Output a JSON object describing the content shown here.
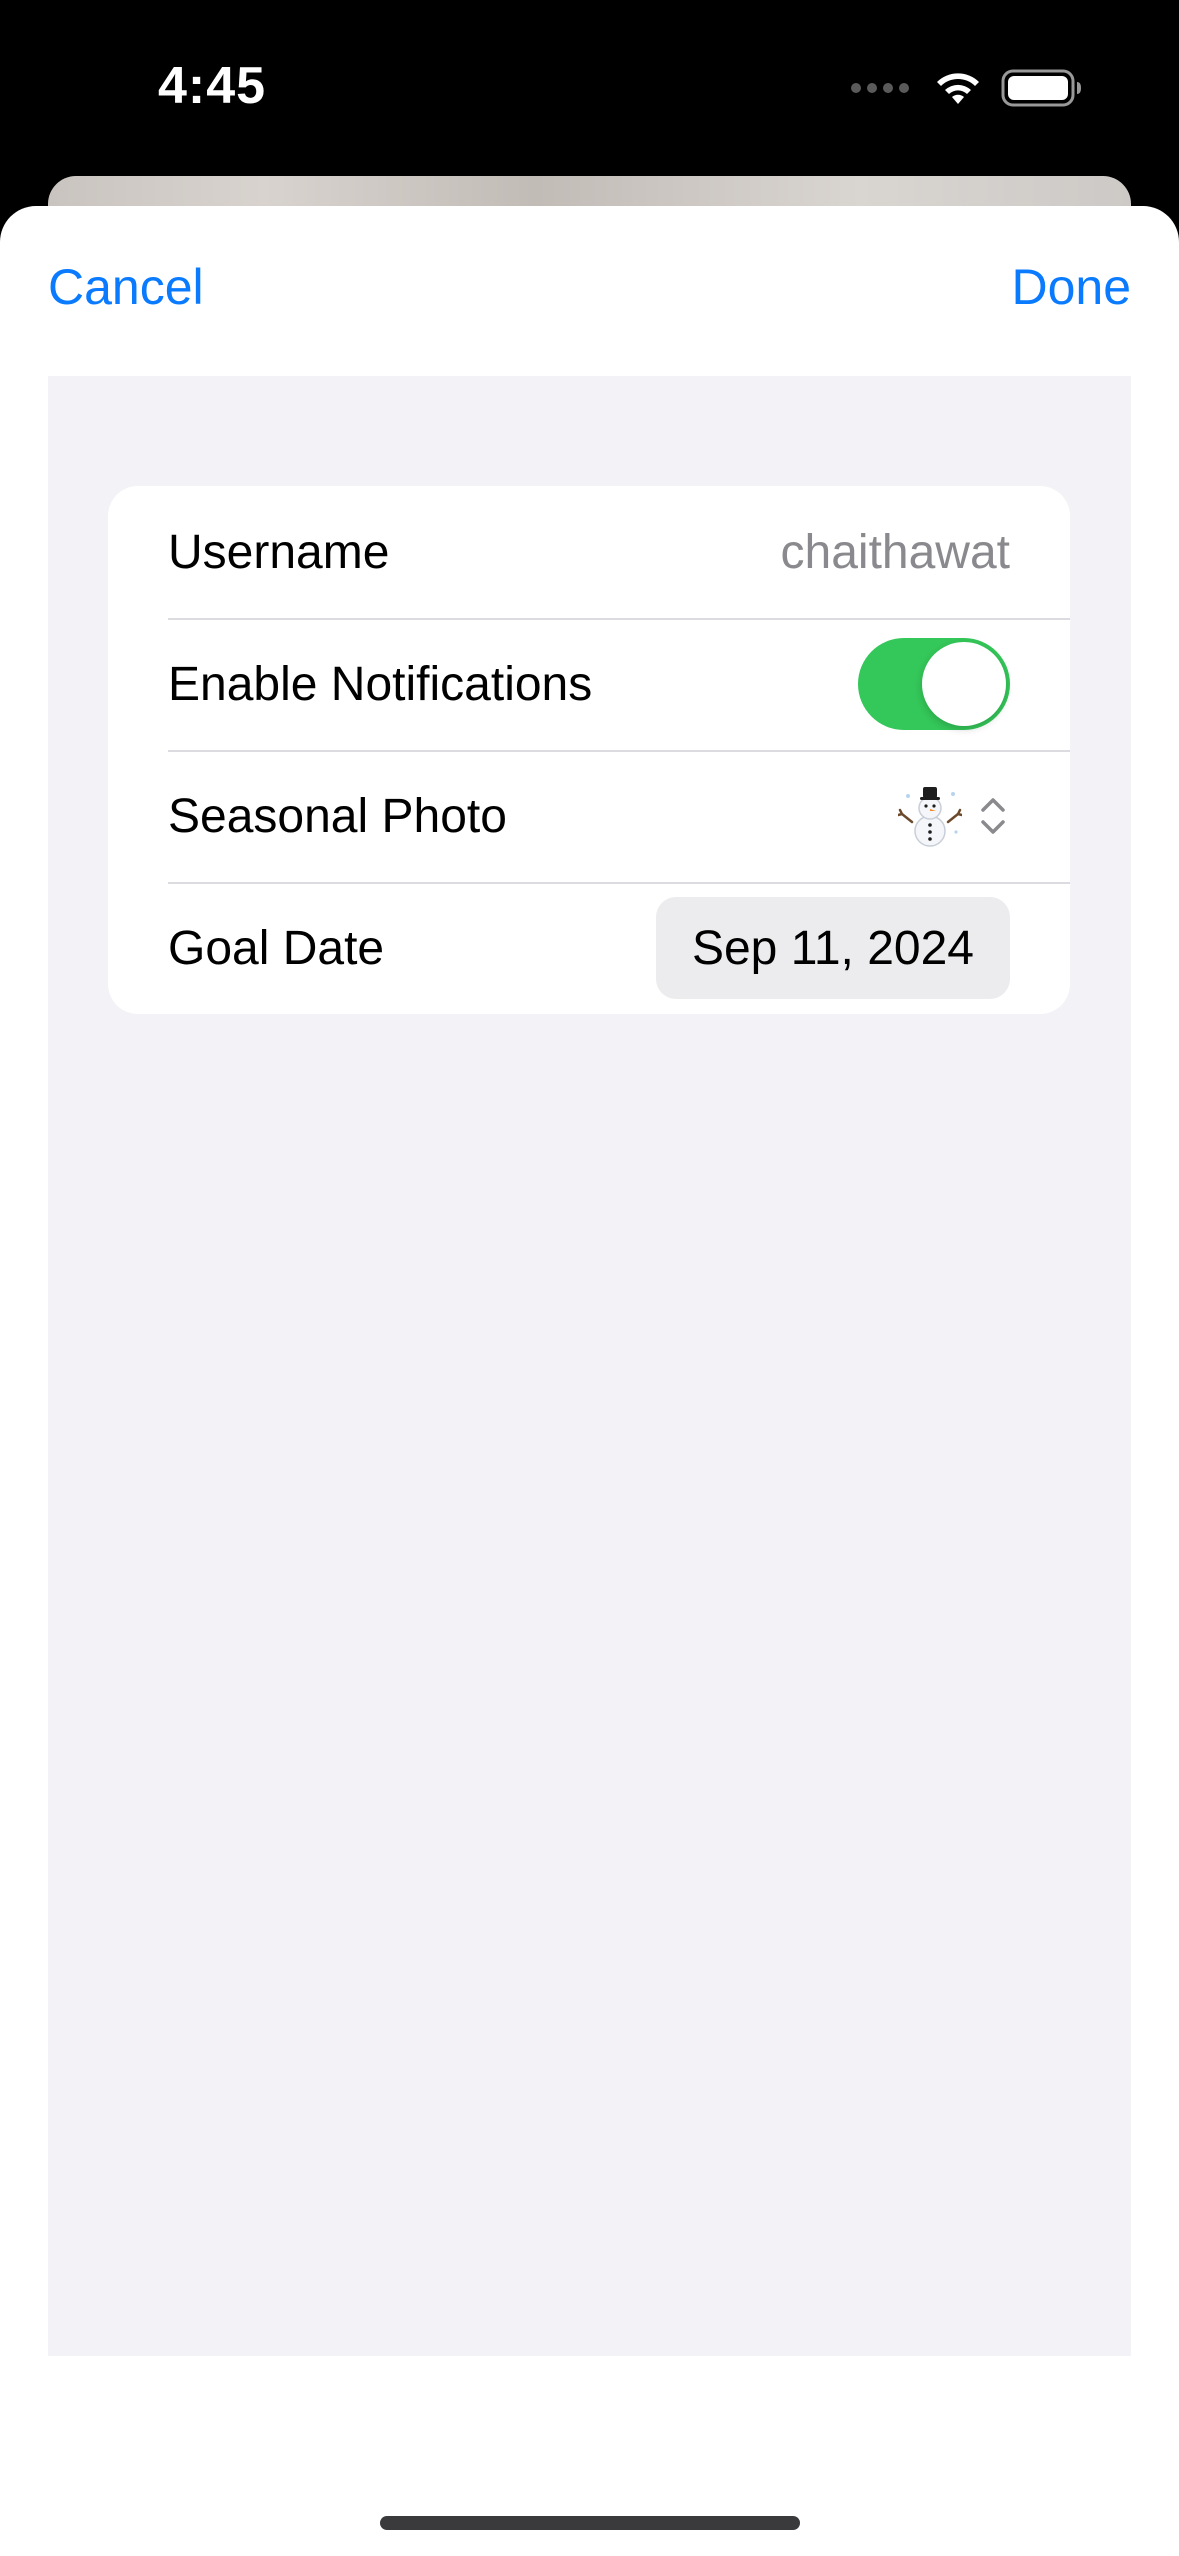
{
  "status_bar": {
    "time": "4:45"
  },
  "nav": {
    "cancel_label": "Cancel",
    "done_label": "Done"
  },
  "form": {
    "username": {
      "label": "Username",
      "value": "chaithawat"
    },
    "notifications": {
      "label": "Enable Notifications",
      "enabled": true
    },
    "seasonal_photo": {
      "label": "Seasonal Photo",
      "selected": "snowman-emoji"
    },
    "goal_date": {
      "label": "Goal Date",
      "value": "Sep 11, 2024"
    }
  },
  "colors": {
    "accent": "#0a7aff",
    "toggle_on": "#34c759",
    "grouped_background": "#f2f2f7",
    "secondary_text": "#8a8a8e"
  },
  "icons": {
    "cellular": "cellular-dots-icon",
    "wifi": "wifi-icon",
    "battery": "battery-icon",
    "picker_chevrons": "chevron-up-down-icon"
  }
}
